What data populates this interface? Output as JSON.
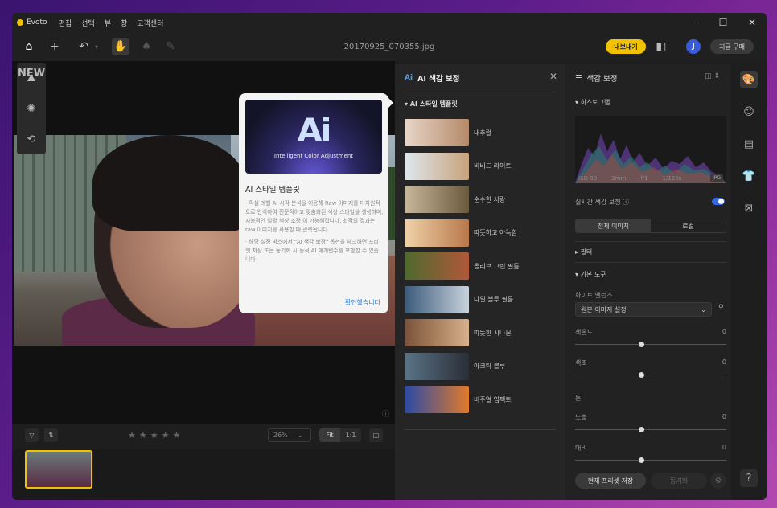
{
  "app": {
    "name": "Evoto",
    "filename": "20170925_070355.jpg"
  },
  "menu": [
    "편집",
    "선택",
    "뷰",
    "창",
    "고객센터"
  ],
  "window_controls": {
    "minimize": "—",
    "maximize": "☐",
    "close": "✕"
  },
  "toolbar": {
    "export_label": "내보내기",
    "avatar_letter": "J",
    "buy_label": "지금 구매"
  },
  "left_tools": {
    "new_tag": "NEW"
  },
  "bottom": {
    "zoom": "26%",
    "fit": "Fit",
    "one": "1:1"
  },
  "popup": {
    "banner_text": "Ai",
    "banner_caption": "Intelligent Color Adjustment",
    "title": "AI 스타일 템플릿",
    "body1": "· 픽셀 레벨 AI 시각 분석을 이용해 Raw 이미지를 다차원적으로 인식하여 전문적이고 맞춤화된 색상 스타일을 생성하며, 지능적인 일괄 색상 조정 이 가능해집니다. 최적의 결과는 raw 이미지를 사용할 때 관측됩니다.",
    "body2": "· 해당 설정 박스에서 \"AI 색감 보정\" 옵션을 체크하면 프리셋 저장 또는 동기화 시 동적 AI 매개변수를 포함할 수 있습니다",
    "ok": "확인했습니다"
  },
  "ai_panel": {
    "icon": "Ai",
    "title": "AI 색감 보정",
    "section": "AI 스타일 템플릿",
    "templates": [
      {
        "label": "내추럴",
        "c1": "#e8d6c8",
        "c2": "#b58a6a"
      },
      {
        "label": "비비드 라이트",
        "c1": "#dfe8ee",
        "c2": "#c8a27a"
      },
      {
        "label": "순수한 사랑",
        "c1": "#c9b79a",
        "c2": "#6a5a3e"
      },
      {
        "label": "따뜻하고 아늑함",
        "c1": "#f0d2a8",
        "c2": "#b8784a"
      },
      {
        "label": "올리브 그린 필름",
        "c1": "#4e6a2e",
        "c2": "#b0583a"
      },
      {
        "label": "나일 블루 필름",
        "c1": "#3a5a7a",
        "c2": "#c8d2dc"
      },
      {
        "label": "따뜻한 시나몬",
        "c1": "#7a5238",
        "c2": "#d8b08a"
      },
      {
        "label": "아크틱 블루",
        "c1": "#5a7488",
        "c2": "#2a2e36"
      },
      {
        "label": "비주얼 임팩트",
        "c1": "#2a4aa8",
        "c2": "#e07a2a"
      }
    ]
  },
  "side_panel": {
    "title": "색감 보정",
    "histogram": "히스토그램",
    "exif": [
      "ISO 80",
      "2mm",
      "f/1",
      "1/120s"
    ],
    "badge": "JPG",
    "realtime": "실시간 색감 보정",
    "seg_all": "전체 이미지",
    "seg_local": "로컬",
    "filter": "필터",
    "basic": "기본 도구",
    "wb_label": "화이트 밸런스",
    "wb_value": "원본 이미지 설정",
    "temp_label": "색온도",
    "temp_value": "0",
    "tint_label": "색조",
    "tint_value": "0",
    "tone_label": "톤",
    "exposure_label": "노출",
    "exposure_value": "0",
    "contrast_label": "대비",
    "contrast_value": "0",
    "save_preset": "현재 프리셋 저장",
    "sync": "동기화"
  },
  "help": "?"
}
